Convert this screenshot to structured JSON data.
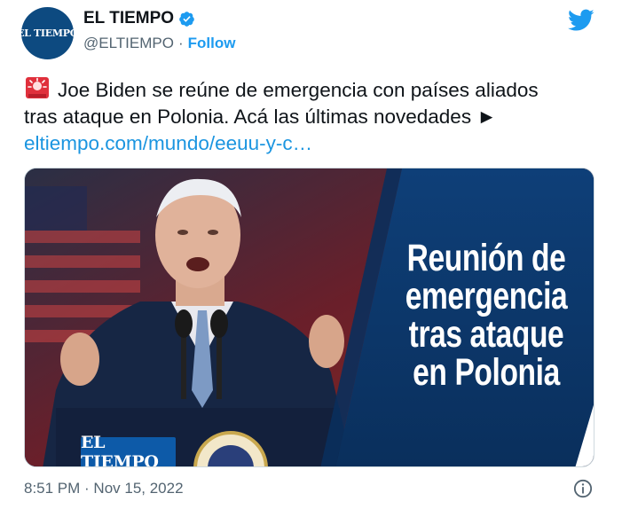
{
  "account": {
    "avatar_text": "EL TIEMPO",
    "display_name": "EL TIEMPO",
    "handle": "@ELTIEMPO",
    "separator": "·",
    "follow_label": "Follow"
  },
  "tweet": {
    "text_line1": "Joe Biden se reúne de emergencia con países aliados",
    "text_line2": "tras ataque en Polonia. Acá las últimas novedades ►",
    "link_text": "eltiempo.com/mundo/eeuu-y-c…",
    "timestamp": "8:51 PM · Nov 15, 2022"
  },
  "media": {
    "headline": [
      "Reunión de",
      "emergencia",
      "tras ataque",
      "en Polonia"
    ],
    "brand_badge": "EL TIEMPO"
  },
  "icons": {
    "verified": "verified-badge-icon",
    "platform": "twitter-bird-icon",
    "siren": "police-light-emoji",
    "info": "info-icon"
  },
  "colors": {
    "accent": "#1d9bf0",
    "link": "#1b95e0",
    "muted": "#536471",
    "brand_blue": "#0d4a80"
  }
}
